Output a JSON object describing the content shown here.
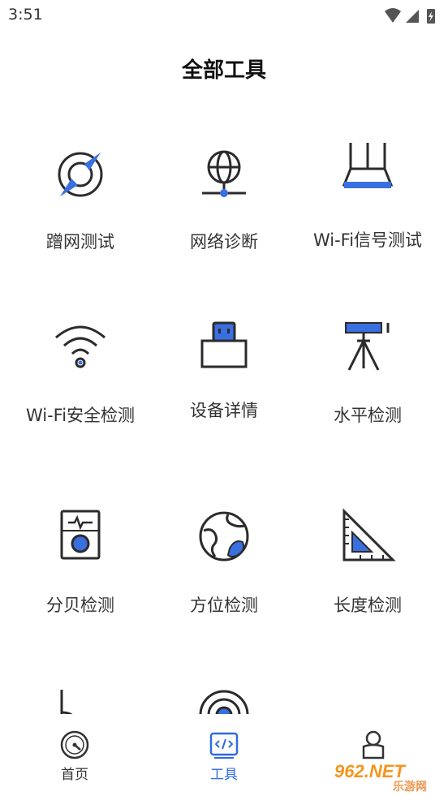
{
  "status_bar": {
    "time": "3:51"
  },
  "header": {
    "title": "全部工具"
  },
  "tools": [
    {
      "label": "蹭网测试",
      "icon": "compass-icon"
    },
    {
      "label": "网络诊断",
      "icon": "globe-network-icon"
    },
    {
      "label": "Wi-Fi信号测试",
      "icon": "router-icon"
    },
    {
      "label": "Wi-Fi安全检测",
      "icon": "wifi-icon"
    },
    {
      "label": "设备详情",
      "icon": "usb-device-icon"
    },
    {
      "label": "水平检测",
      "icon": "tripod-level-icon"
    },
    {
      "label": "分贝检测",
      "icon": "decibel-meter-icon"
    },
    {
      "label": "方位检测",
      "icon": "earth-icon"
    },
    {
      "label": "长度检测",
      "icon": "set-square-ruler-icon"
    }
  ],
  "bottom_nav": [
    {
      "label": "首页",
      "icon": "speedometer-icon"
    },
    {
      "label": "工具",
      "icon": "code-window-icon"
    },
    {
      "label": "",
      "icon": "person-icon"
    }
  ],
  "watermark": {
    "text_big": "962.NET",
    "text_small": "乐游网"
  },
  "colors": {
    "accent": "#2d6be6",
    "icon_stroke": "#2b2b2b",
    "icon_fill": "#3a6fe0"
  }
}
